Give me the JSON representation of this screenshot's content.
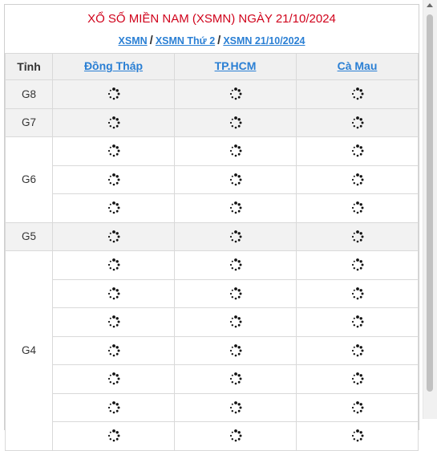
{
  "header": {
    "title": "XỔ SỐ MIỀN NAM (XSMN) NGÀY 21/10/2024",
    "links": [
      "XSMN",
      "XSMN Thứ 2",
      "XSMN 21/10/2024"
    ],
    "separator": "/"
  },
  "table": {
    "tinh_label": "Tỉnh",
    "provinces": [
      "Đồng Tháp",
      "TP.HCM",
      "Cà Mau"
    ],
    "prizes": [
      {
        "label": "G8",
        "rows": 1,
        "shaded": true
      },
      {
        "label": "G7",
        "rows": 1,
        "shaded": true
      },
      {
        "label": "G6",
        "rows": 3,
        "shaded": false
      },
      {
        "label": "G5",
        "rows": 1,
        "shaded": true
      },
      {
        "label": "G4",
        "rows": 7,
        "shaded": false
      }
    ],
    "cell_state_icon": "loading-spinner-icon"
  },
  "colors": {
    "title_red": "#d0021b",
    "link_blue": "#2a7fd4",
    "row_shade": "#f2f2f2"
  }
}
